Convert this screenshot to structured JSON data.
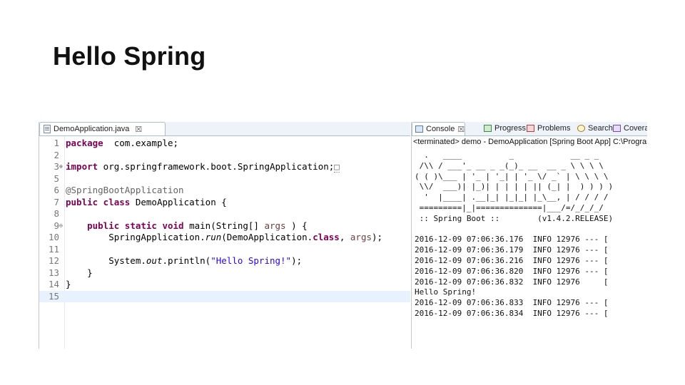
{
  "slide": {
    "title": "Hello Spring"
  },
  "editor": {
    "tab_label": "DemoApplication.java",
    "tab_close": "☒",
    "lines": [
      {
        "n": "1",
        "segs": [
          [
            "kw",
            "package"
          ],
          [
            "",
            "  com.example;"
          ]
        ]
      },
      {
        "n": "2",
        "segs": []
      },
      {
        "n": "3",
        "marker": "⊕",
        "segs": [
          [
            "kw",
            "import"
          ],
          [
            "",
            " org.springframework.boot.SpringApplication;"
          ],
          [
            "lnk",
            "□"
          ]
        ]
      },
      {
        "n": "5",
        "segs": []
      },
      {
        "n": "6",
        "segs": [
          [
            "ann",
            "@SpringBootApplication"
          ]
        ]
      },
      {
        "n": "7",
        "segs": [
          [
            "kw",
            "public class"
          ],
          [
            "",
            " DemoApplication {"
          ]
        ]
      },
      {
        "n": "8",
        "segs": []
      },
      {
        "n": "9",
        "marker": "⊖",
        "segs": [
          [
            "",
            "    "
          ],
          [
            "kw",
            "public static void"
          ],
          [
            "",
            " main(String[] "
          ],
          [
            "var",
            "args"
          ],
          [
            "",
            " ) {"
          ]
        ]
      },
      {
        "n": "10",
        "segs": [
          [
            "",
            "        SpringApplication."
          ],
          [
            "it",
            "run"
          ],
          [
            "",
            "(DemoApplication."
          ],
          [
            "kw",
            "class"
          ],
          [
            ", ",
            ", "
          ],
          [
            "var",
            "args"
          ],
          [
            "",
            ");"
          ]
        ]
      },
      {
        "n": "11",
        "segs": []
      },
      {
        "n": "12",
        "segs": [
          [
            "",
            "        System."
          ],
          [
            "it",
            "out"
          ],
          [
            ".println(",
            ".println("
          ],
          [
            "str",
            "\"Hello Spring!\""
          ],
          [
            "",
            ");"
          ]
        ]
      },
      {
        "n": "13",
        "segs": [
          [
            "",
            "    }"
          ]
        ]
      },
      {
        "n": "14",
        "segs": [
          [
            "",
            "}"
          ]
        ]
      },
      {
        "n": "15",
        "cursor": true,
        "segs": []
      }
    ]
  },
  "console": {
    "tabs": [
      {
        "label": "Console",
        "icon": "console-icon",
        "close": "☒",
        "active": true
      },
      {
        "label": "Progress",
        "icon": "progress-icon"
      },
      {
        "label": "Problems",
        "icon": "problems-icon"
      },
      {
        "label": "Search",
        "icon": "search-icon"
      },
      {
        "label": "Covera",
        "icon": "coverage-icon"
      }
    ],
    "status": "<terminated> demo - DemoApplication [Spring Boot App] C:\\Program",
    "banner": [
      "  .   ____          _            __ _ _",
      " /\\\\ / ___'_ __ _ _(_)_ __  __ _ \\ \\ \\ \\",
      "( ( )\\___ | '_ | '_| | '_ \\/ _` | \\ \\ \\ \\",
      " \\\\/  ___)| |_)| | | | | || (_| |  ) ) ) )",
      "  '  |____| .__|_| |_|_| |_\\__, | / / / /",
      " =========|_|==============|___/=/_/_/_/",
      " :: Spring Boot ::        (v1.4.2.RELEASE)"
    ],
    "log": [
      "2016-12-09 07:06:36.176  INFO 12976 --- [",
      "2016-12-09 07:06:36.179  INFO 12976 --- [",
      "2016-12-09 07:06:36.216  INFO 12976 --- [",
      "2016-12-09 07:06:36.820  INFO 12976 --- [",
      "2016-12-09 07:06:36.832  INFO 12976     [",
      "Hello Spring!",
      "2016-12-09 07:06:36.833  INFO 12976 --- [",
      "2016-12-09 07:06:36.834  INFO 12976 --- ["
    ]
  }
}
